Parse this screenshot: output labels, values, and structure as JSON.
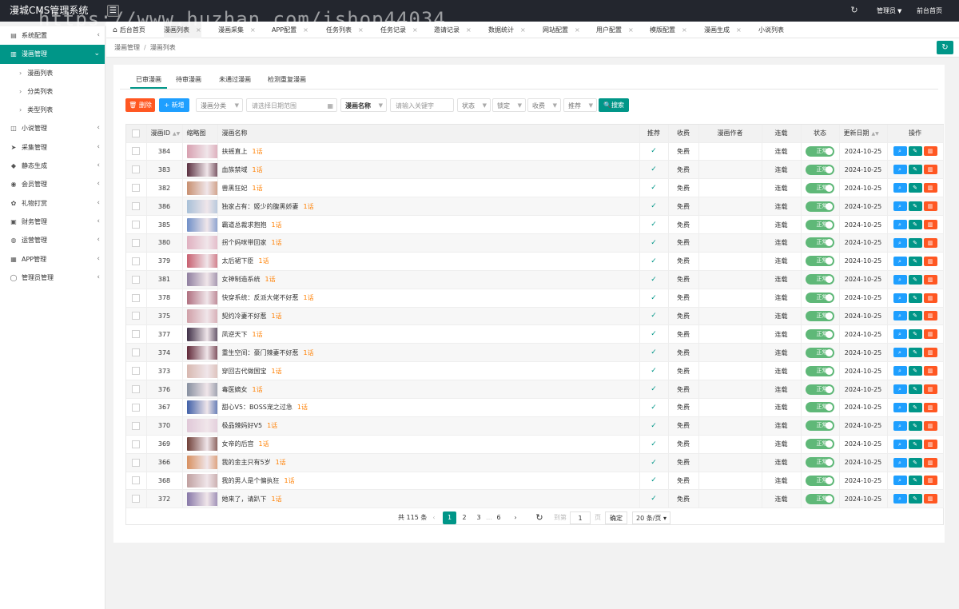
{
  "app": {
    "title": "漫城CMS管理系统",
    "admin": "管理员",
    "front": "前台首页"
  },
  "icons": {
    "menu": "hamburger-icon",
    "refresh": "refresh-icon",
    "caret": "caret-down-icon"
  },
  "sidebar": {
    "items": [
      {
        "label": "系统配置",
        "icon": "▤"
      },
      {
        "label": "漫画管理",
        "icon": "▥",
        "active": true
      },
      {
        "label": "小说管理",
        "icon": "◫"
      },
      {
        "label": "采集管理",
        "icon": "➤"
      },
      {
        "label": "静态生成",
        "icon": "◆"
      },
      {
        "label": "会员管理",
        "icon": "◉"
      },
      {
        "label": "礼物打赏",
        "icon": "✿"
      },
      {
        "label": "财务管理",
        "icon": "▣"
      },
      {
        "label": "运营管理",
        "icon": "◍"
      },
      {
        "label": "APP管理",
        "icon": "▦"
      },
      {
        "label": "管理员管理",
        "icon": "◯"
      }
    ],
    "sub": [
      "漫画列表",
      "分类列表",
      "类型列表"
    ]
  },
  "tabs": [
    "后台首页",
    "漫画列表",
    "漫画采集",
    "APP配置",
    "任务列表",
    "任务记录",
    "邀请记录",
    "数据统计",
    "网站配置",
    "用户配置",
    "模版配置",
    "漫画生成",
    "小说列表"
  ],
  "breadcrumb": [
    "漫画管理",
    "漫画列表"
  ],
  "subtabs": [
    "已审漫画",
    "待审漫画",
    "未通过漫画",
    "检测重复漫画"
  ],
  "toolbar": {
    "delete": "删除",
    "add": "新增",
    "category": "漫画分类",
    "date_placeholder": "请选择日期范围",
    "field": "漫画名称",
    "keyword_placeholder": "请输入关键字",
    "status": "状态",
    "lock": "锁定",
    "charge": "收费",
    "recommend": "推荐",
    "search": "搜索"
  },
  "table": {
    "headers": [
      "漫画ID",
      "缩略图",
      "漫画名称",
      "推荐",
      "收费",
      "漫画作者",
      "连载",
      "状态",
      "更新日期",
      "操作"
    ],
    "rows": [
      {
        "id": "384",
        "name": "扶摇直上",
        "ep": "1话",
        "charge": "免费",
        "serial": "连载",
        "status": "正常",
        "date": "2024-10-25",
        "thumb": "#d8a0b0"
      },
      {
        "id": "383",
        "name": "血族禁域",
        "ep": "1话",
        "charge": "免费",
        "serial": "连载",
        "status": "正常",
        "date": "2024-10-25",
        "thumb": "#5a3040"
      },
      {
        "id": "382",
        "name": "兽黑狂妃",
        "ep": "1话",
        "charge": "免费",
        "serial": "连载",
        "status": "正常",
        "date": "2024-10-25",
        "thumb": "#c89070"
      },
      {
        "id": "386",
        "name": "独家占有：姬少的腹黑娇妻",
        "ep": "1话",
        "charge": "免费",
        "serial": "连载",
        "status": "正常",
        "date": "2024-10-25",
        "thumb": "#a8c0d8"
      },
      {
        "id": "385",
        "name": "霸道总裁求抱抱",
        "ep": "1话",
        "charge": "免费",
        "serial": "连载",
        "status": "正常",
        "date": "2024-10-25",
        "thumb": "#7090c8"
      },
      {
        "id": "380",
        "name": "拐个妈咪带回家",
        "ep": "1话",
        "charge": "免费",
        "serial": "连载",
        "status": "正常",
        "date": "2024-10-25",
        "thumb": "#e0b0c0"
      },
      {
        "id": "379",
        "name": "太后裙下臣",
        "ep": "1话",
        "charge": "免费",
        "serial": "连载",
        "status": "正常",
        "date": "2024-10-25",
        "thumb": "#c86070"
      },
      {
        "id": "381",
        "name": "女神制造系统",
        "ep": "1话",
        "charge": "免费",
        "serial": "连载",
        "status": "正常",
        "date": "2024-10-25",
        "thumb": "#9080a0"
      },
      {
        "id": "378",
        "name": "快穿系统：反派大佬不好惹",
        "ep": "1话",
        "charge": "免费",
        "serial": "连载",
        "status": "正常",
        "date": "2024-10-25",
        "thumb": "#b07080"
      },
      {
        "id": "375",
        "name": "契约冷妻不好惹",
        "ep": "1话",
        "charge": "免费",
        "serial": "连载",
        "status": "正常",
        "date": "2024-10-25",
        "thumb": "#d0a0a8"
      },
      {
        "id": "377",
        "name": "凤逆天下",
        "ep": "1话",
        "charge": "免费",
        "serial": "连载",
        "status": "正常",
        "date": "2024-10-25",
        "thumb": "#403048"
      },
      {
        "id": "374",
        "name": "重生空间：豪门辣妻不好惹",
        "ep": "1话",
        "charge": "免费",
        "serial": "连载",
        "status": "正常",
        "date": "2024-10-25",
        "thumb": "#602838"
      },
      {
        "id": "373",
        "name": "穿回古代做国宝",
        "ep": "1话",
        "charge": "免费",
        "serial": "连载",
        "status": "正常",
        "date": "2024-10-25",
        "thumb": "#d8b8b0"
      },
      {
        "id": "376",
        "name": "毒医嫡女",
        "ep": "1话",
        "charge": "免费",
        "serial": "连载",
        "status": "正常",
        "date": "2024-10-25",
        "thumb": "#8890a0"
      },
      {
        "id": "367",
        "name": "甜心V5：BOSS宠之过急",
        "ep": "1话",
        "charge": "免费",
        "serial": "连载",
        "status": "正常",
        "date": "2024-10-25",
        "thumb": "#4060a8"
      },
      {
        "id": "370",
        "name": "极品辣妈好V5",
        "ep": "1话",
        "charge": "免费",
        "serial": "连载",
        "status": "正常",
        "date": "2024-10-25",
        "thumb": "#e0c8d8"
      },
      {
        "id": "369",
        "name": "女帝的后宫",
        "ep": "1话",
        "charge": "免费",
        "serial": "连载",
        "status": "正常",
        "date": "2024-10-25",
        "thumb": "#704038"
      },
      {
        "id": "366",
        "name": "我的金主只有5岁",
        "ep": "1话",
        "charge": "免费",
        "serial": "连载",
        "status": "正常",
        "date": "2024-10-25",
        "thumb": "#d89060"
      },
      {
        "id": "368",
        "name": "我的男人是个偏执狂",
        "ep": "1话",
        "charge": "免费",
        "serial": "连载",
        "status": "正常",
        "date": "2024-10-25",
        "thumb": "#c0a0a0"
      },
      {
        "id": "372",
        "name": "她来了，请趴下",
        "ep": "1话",
        "charge": "免费",
        "serial": "连载",
        "status": "正常",
        "date": "2024-10-25",
        "thumb": "#8878a8"
      }
    ]
  },
  "pager": {
    "total": "共 115 条",
    "pages": [
      "1",
      "2",
      "3"
    ],
    "ellipsis": "…",
    "last": "6",
    "goto": "到第",
    "page_value": "1",
    "page_unit": "页",
    "confirm": "确定",
    "size": "20 条/页"
  },
  "watermark": "https://www.huzhan.com/ishop44034",
  "colors": {
    "accent": "#009688",
    "danger": "#ff5722",
    "info": "#1e9fff",
    "success": "#5fb878",
    "episode": "#ff7f00"
  }
}
